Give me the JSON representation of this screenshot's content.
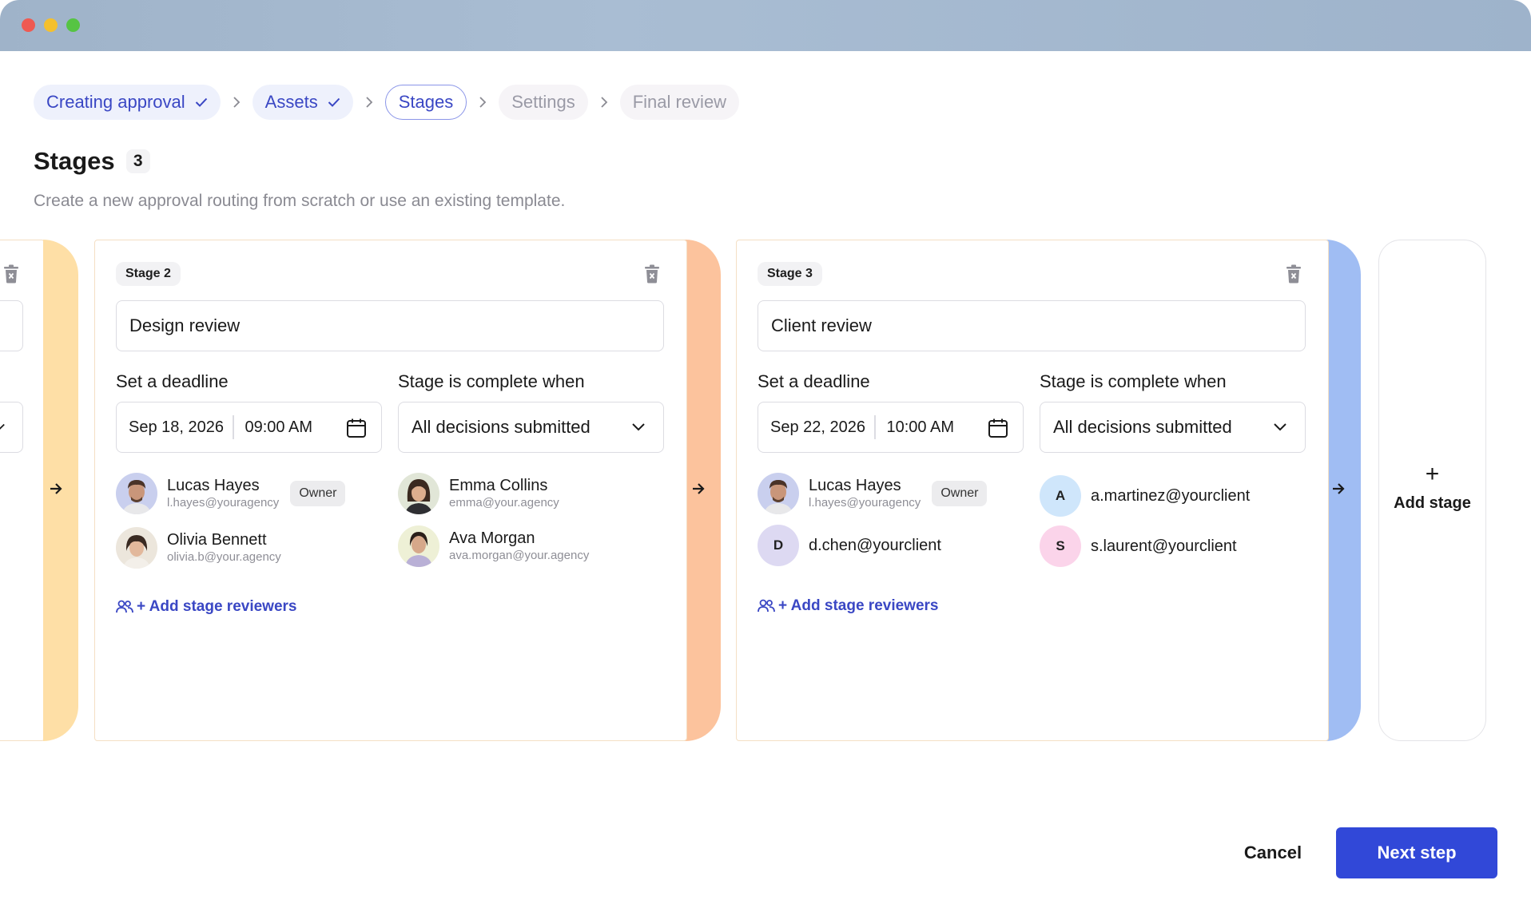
{
  "window": {
    "buttons": [
      "close",
      "minimize",
      "maximize"
    ]
  },
  "breadcrumb": [
    {
      "label": "Creating approval",
      "state": "done"
    },
    {
      "label": "Assets",
      "state": "done"
    },
    {
      "label": "Stages",
      "state": "active"
    },
    {
      "label": "Settings",
      "state": "future"
    },
    {
      "label": "Final review",
      "state": "future"
    }
  ],
  "page": {
    "title": "Stages",
    "count": "3",
    "subtitle": "Create a new approval routing from scratch or use an existing template."
  },
  "stages": [
    {
      "label": "Stage 2",
      "name": "Design review",
      "deadline_label": "Set a deadline",
      "date": "Sep 18, 2026",
      "time": "09:00 AM",
      "complete_label": "Stage is complete when",
      "complete_value": "All decisions submitted",
      "tab_color": "#fcc39d",
      "reviewers": [
        {
          "name": "Lucas Hayes",
          "email": "l.hayes@youragency",
          "badge": "Owner",
          "avatar_bg": "#c9cfee"
        },
        {
          "name": "Olivia Bennett",
          "email": "olivia.b@your.agency",
          "avatar_bg": "#ece6dc"
        },
        {
          "name": "Emma Collins",
          "email": "emma@your.agency",
          "avatar_bg": "#e1e6d7"
        },
        {
          "name": "Ava Morgan",
          "email": "ava.morgan@your.agency",
          "avatar_bg": "#eef0d6"
        }
      ],
      "add_reviewers": "+ Add stage reviewers"
    },
    {
      "label": "Stage 3",
      "name": "Client review",
      "deadline_label": "Set a deadline",
      "date": "Sep 22, 2026",
      "time": "10:00 AM",
      "complete_label": "Stage is complete when",
      "complete_value": "All decisions submitted",
      "tab_color": "#a0bdf3",
      "reviewers": [
        {
          "name": "Lucas Hayes",
          "email": "l.hayes@youragency",
          "badge": "Owner",
          "avatar_bg": "#c9cfee"
        },
        {
          "initial": "D",
          "email": "d.chen@yourclient",
          "avatar_bg": "#ddd9f2"
        },
        {
          "initial": "A",
          "email": "a.martinez@yourclient",
          "avatar_bg": "#cfe6fb"
        },
        {
          "initial": "S",
          "email": "s.laurent@yourclient",
          "avatar_bg": "#fbd4ea"
        }
      ],
      "add_reviewers": "+ Add stage reviewers"
    }
  ],
  "stage_prev": {
    "tab_color": "#fedfa6"
  },
  "add_stage": {
    "plus": "+",
    "label": "Add stage"
  },
  "footer": {
    "cancel": "Cancel",
    "next": "Next step"
  },
  "colors": {
    "accent": "#3148d8",
    "link": "#3a47c4"
  }
}
